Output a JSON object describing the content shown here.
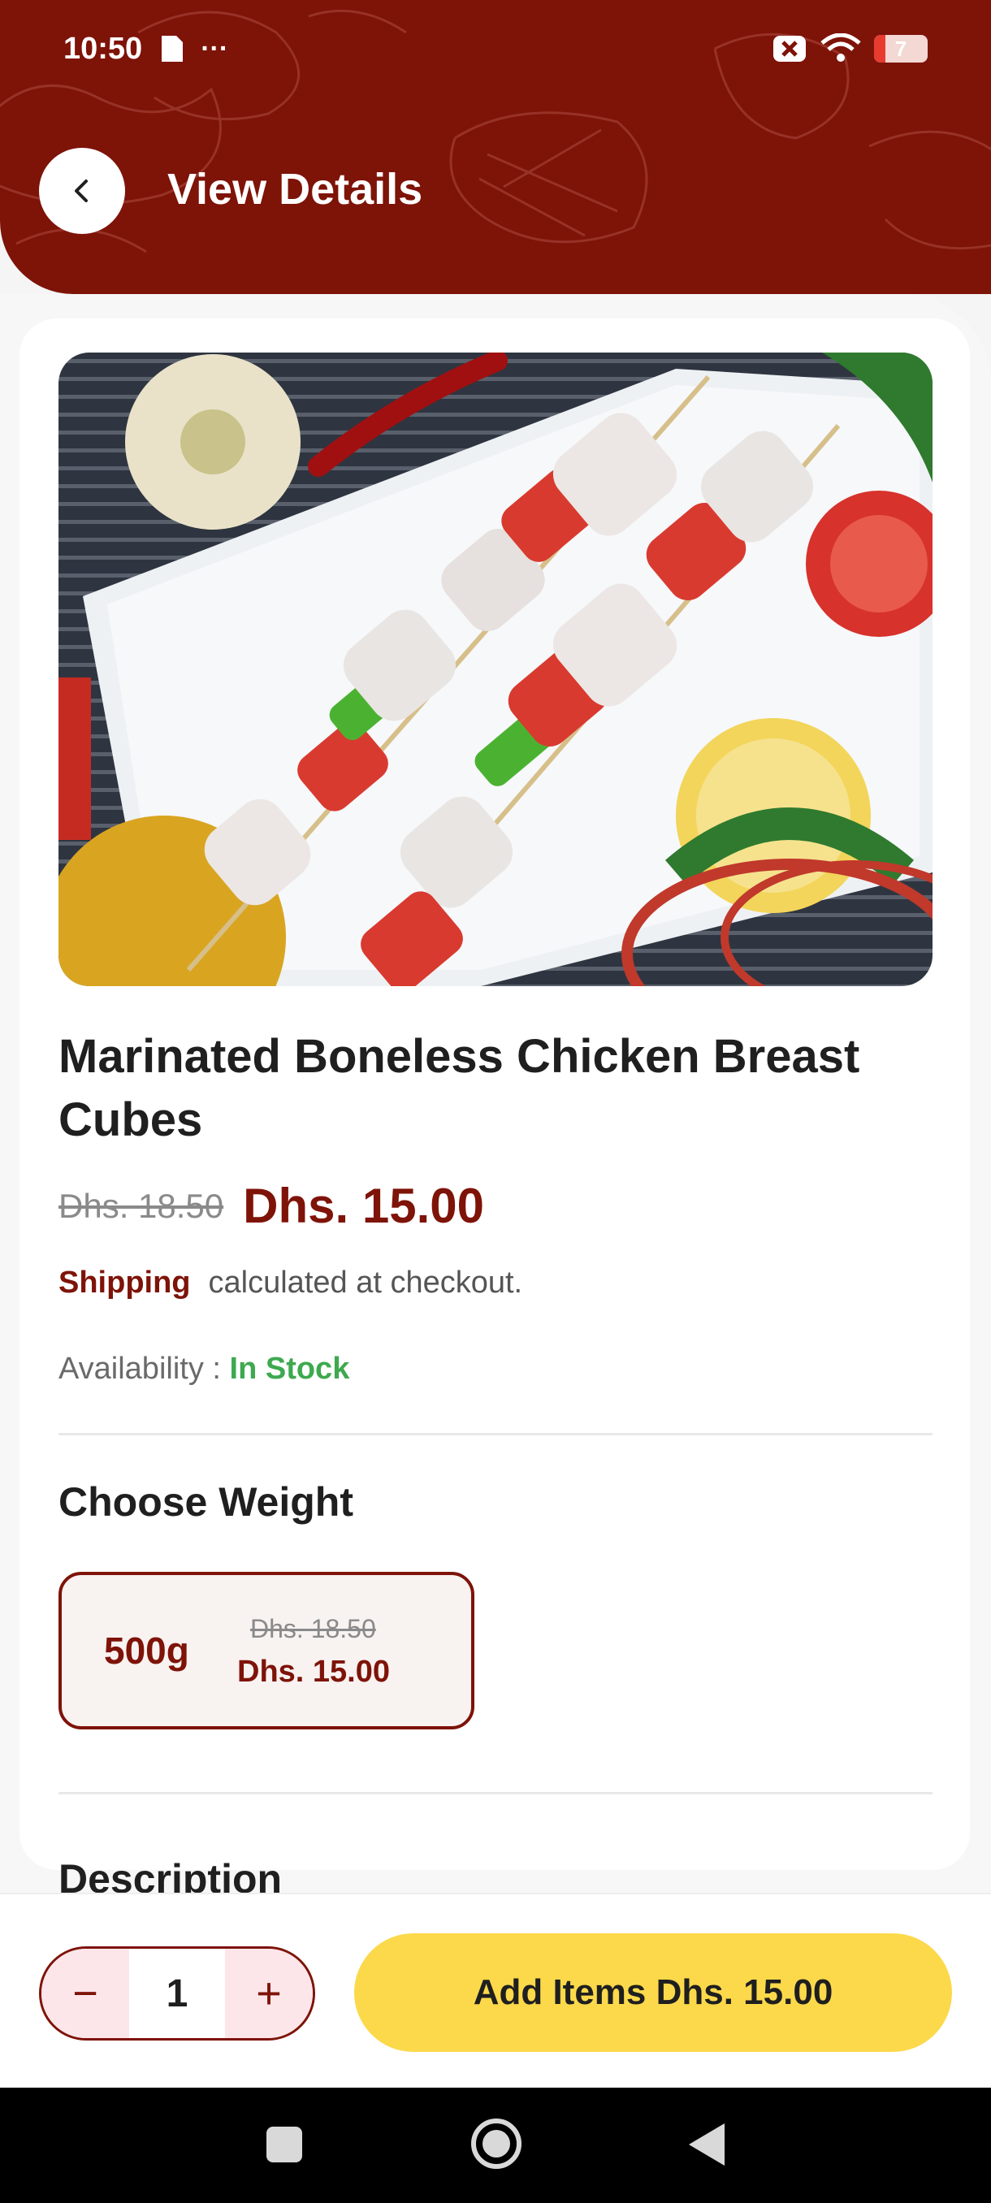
{
  "status_bar": {
    "time": "10:50",
    "more": "···",
    "battery_level": "7",
    "icons": [
      "document-icon",
      "more-icon",
      "sim-error-icon",
      "wifi-icon",
      "battery-icon"
    ]
  },
  "header": {
    "title": "View Details",
    "back_icon": "chevron-left-icon",
    "background_color": "#7e1308"
  },
  "product": {
    "name": "Marinated Boneless Chicken Breast Cubes",
    "old_price": "Dhs. 18.50",
    "price": "Dhs. 15.00",
    "shipping_label": "Shipping",
    "shipping_text": "calculated at checkout.",
    "availability_label": "Availability :",
    "availability_value": "In Stock"
  },
  "weight": {
    "heading": "Choose Weight",
    "options": [
      {
        "label": "500g",
        "old_price": "Dhs. 18.50",
        "price": "Dhs. 15.00",
        "selected": true
      }
    ]
  },
  "description": {
    "heading": "Description"
  },
  "cart": {
    "minus": "−",
    "quantity": "1",
    "plus": "+",
    "add_label": "Add Items Dhs. 15.00",
    "accent": "#fcd94a"
  },
  "nav": {
    "icons": [
      "recents-icon",
      "home-icon",
      "back-icon"
    ]
  }
}
